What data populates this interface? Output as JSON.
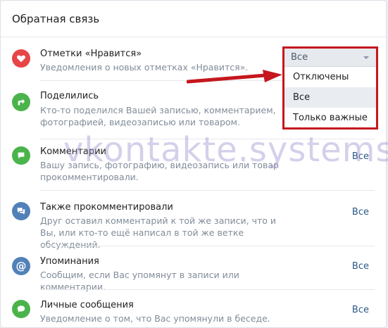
{
  "header": {
    "title": "Обратная связь"
  },
  "items": [
    {
      "label": "Отметки «Нравится»",
      "desc": "Уведомления о новых отметках «Нравится».",
      "value": "",
      "icon": "heart-icon",
      "color": "#e64646"
    },
    {
      "label": "Поделились",
      "desc": "Кто-то поделился Вашей записью, комментарием, фотографией, видеозаписью или товаром.",
      "value": "",
      "icon": "share-icon",
      "color": "#4bb34b"
    },
    {
      "label": "Комментарии",
      "desc": "Вашу запись, фотографию, видеозапись или товар прокомментировали.",
      "value": "Все",
      "icon": "comment-icon",
      "color": "#4bb34b"
    },
    {
      "label": "Также прокомментировали",
      "desc": "Друг оставил комментарий к той же записи, что и Вы, или кто-то ещё написал в той же ветке обсуждений.",
      "value": "Все",
      "icon": "comments-icon",
      "color": "#5181b8"
    },
    {
      "label": "Упоминания",
      "desc": "Сообщим, если Вас упомянут в записи или комментарии.",
      "value": "Все",
      "icon": "at-icon",
      "color": "#5181b8"
    },
    {
      "label": "Личные сообщения",
      "desc": "Уведомление о том, что Вас упомянули в беседе.",
      "value": "Все",
      "icon": "message-icon",
      "color": "#4bb34b"
    }
  ],
  "dropdown": {
    "selected": "Все",
    "options": [
      "Отключены",
      "Все",
      "Только важные"
    ],
    "highlight_color": "#c5171d"
  },
  "watermark": "vkontakte.systems"
}
